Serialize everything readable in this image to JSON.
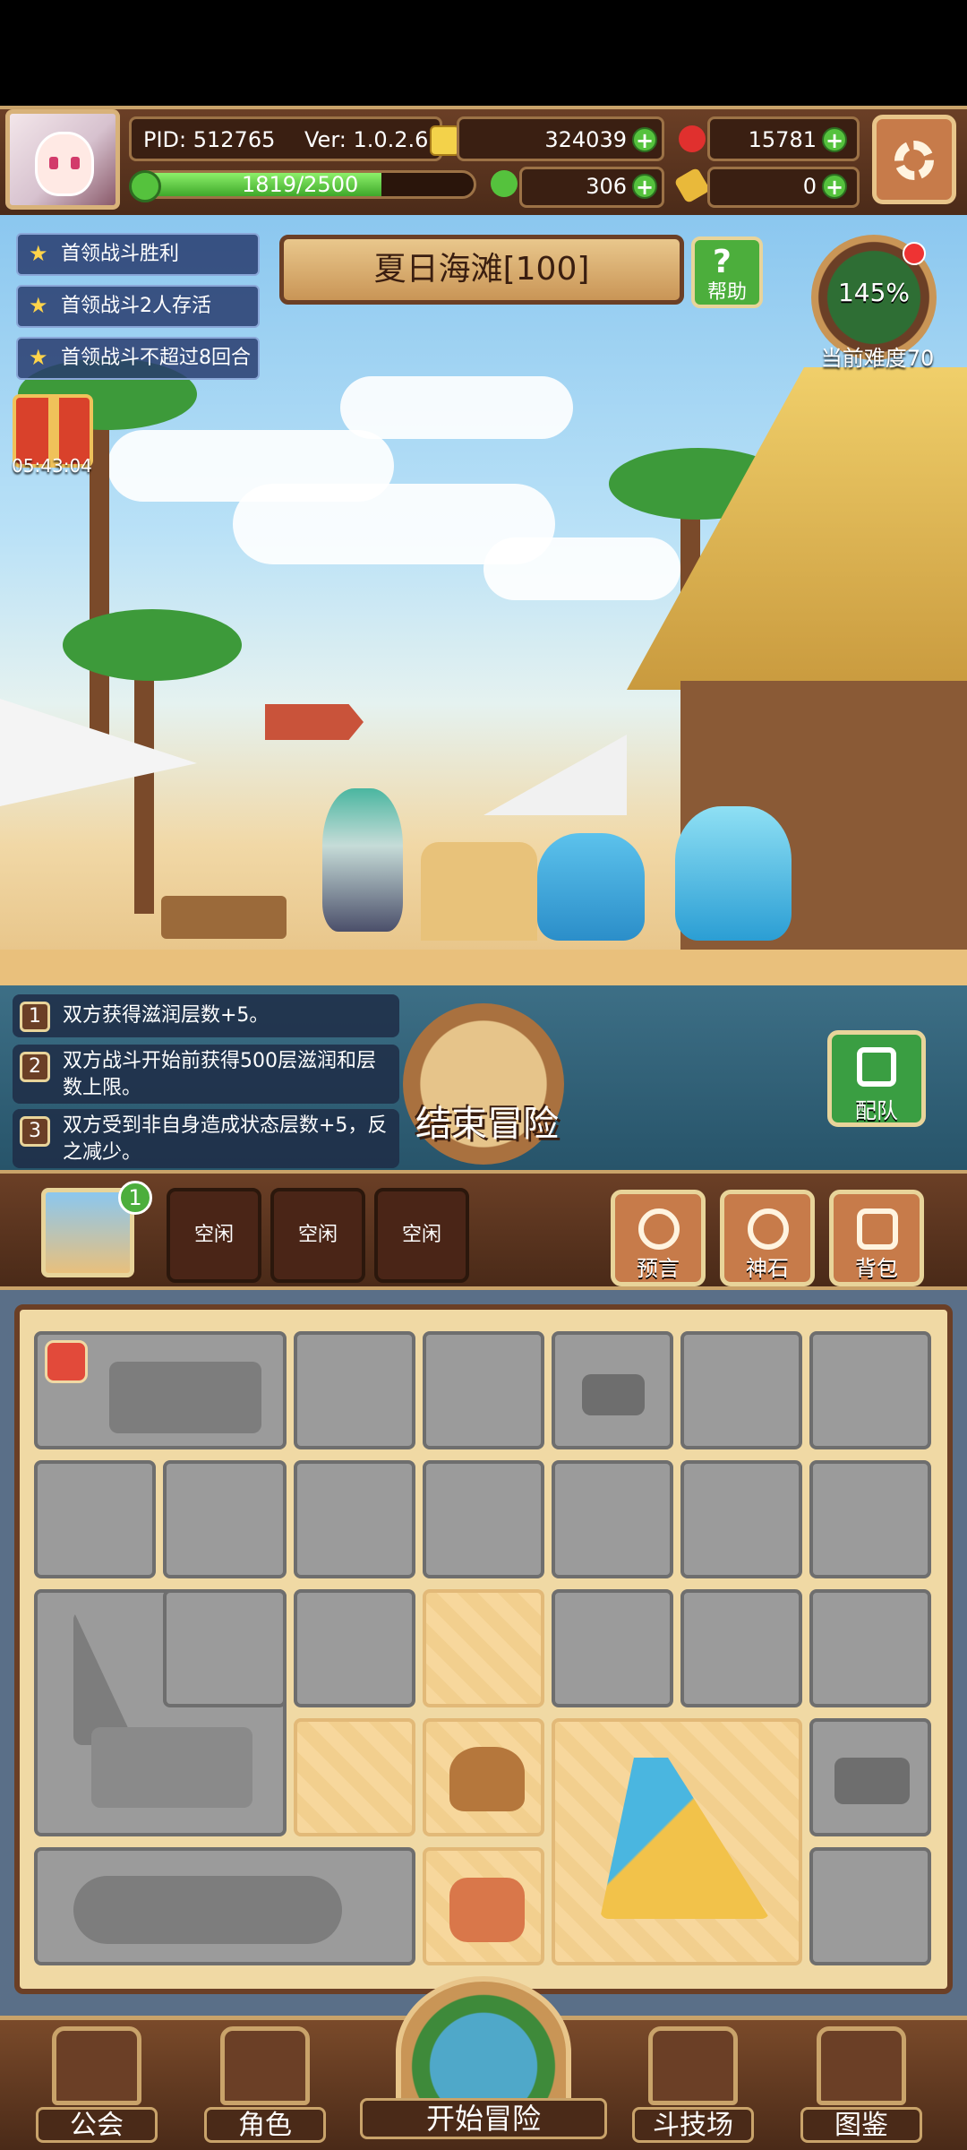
{
  "header": {
    "pid_text": "PID: 512765",
    "version_text": "Ver: 1.0.2.6",
    "gold": "324039",
    "gems": "15781",
    "energy_text": "1819/2500",
    "energy_fraction": 0.7276,
    "clover": "306",
    "keys": "0"
  },
  "quests": [
    "首领战斗胜利",
    "首领战斗2人存活",
    "首领战斗不超过8回合"
  ],
  "stage": {
    "title": "夏日海滩[100]",
    "help_label": "帮助",
    "difficulty_percent": "145%",
    "difficulty_label": "当前难度70"
  },
  "gift": {
    "timer": "05:43:04"
  },
  "effects": [
    {
      "num": "1",
      "text": "双方获得滋润层数+5。"
    },
    {
      "num": "2",
      "text": "双方战斗开始前获得500层滋润和层数上限。"
    },
    {
      "num": "3",
      "text": "双方受到非自身造成状态层数+5，反之减少。"
    }
  ],
  "end_button": {
    "label": "结束冒险"
  },
  "team_button": {
    "label": "配队"
  },
  "actionbar": {
    "map_badge": "1",
    "slots": [
      "空闲",
      "空闲",
      "空闲"
    ],
    "tools": [
      "预言",
      "神石",
      "背包"
    ]
  },
  "nav": {
    "guild": "公会",
    "character": "角色",
    "start": "开始冒险",
    "arena": "斗技场",
    "codex": "图鉴"
  },
  "colors": {
    "wood": "#6b3f26",
    "gold_trim": "#c9a36a",
    "sand_cell": "#f7d79c",
    "locked_cell": "#9b9b9b",
    "plus_green": "#55c23d"
  }
}
